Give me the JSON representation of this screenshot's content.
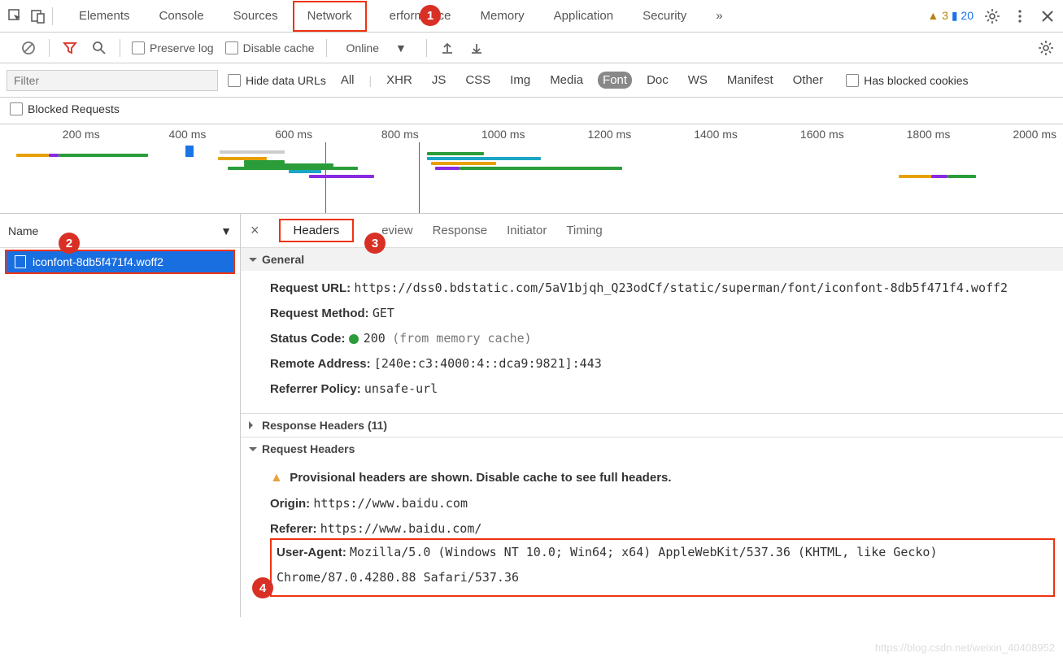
{
  "topTabs": [
    "Elements",
    "Console",
    "Sources",
    "Network",
    "Performance",
    "Memory",
    "Application",
    "Security"
  ],
  "topTabsVisible": {
    "perf": "erformance"
  },
  "warnings": {
    "warnCount": "3",
    "msgCount": "20"
  },
  "toolbar": {
    "preserveLog": "Preserve log",
    "disableCache": "Disable cache",
    "throttle": "Online"
  },
  "filterRow": {
    "placeholder": "Filter",
    "hideData": "Hide data URLs",
    "types": [
      "All",
      "XHR",
      "JS",
      "CSS",
      "Img",
      "Media",
      "Font",
      "Doc",
      "WS",
      "Manifest",
      "Other"
    ],
    "hasBlocked": "Has blocked cookies",
    "blockedReq": "Blocked Requests"
  },
  "timelineTicks": [
    "200 ms",
    "400 ms",
    "600 ms",
    "800 ms",
    "1000 ms",
    "1200 ms",
    "1400 ms",
    "1600 ms",
    "1800 ms",
    "2000 ms"
  ],
  "leftPane": {
    "nameHeader": "Name",
    "item": "iconfont-8db5f471f4.woff2"
  },
  "detailTabs": [
    "Headers",
    "Preview",
    "Response",
    "Initiator",
    "Timing"
  ],
  "detailTabsVisible": {
    "preview": "eview"
  },
  "general": {
    "title": "General",
    "url_lbl": "Request URL:",
    "url_val": "https://dss0.bdstatic.com/5aV1bjqh_Q23odCf/static/superman/font/iconfont-8db5f471f4.woff2",
    "method_lbl": "Request Method:",
    "method_val": "GET",
    "status_lbl": "Status Code:",
    "status_val": "200",
    "status_note": "(from memory cache)",
    "remote_lbl": "Remote Address:",
    "remote_val": "[240e:c3:4000:4::dca9:9821]:443",
    "refpol_lbl": "Referrer Policy:",
    "refpol_val": "unsafe-url"
  },
  "respHeaders": {
    "title": "Response Headers (11)"
  },
  "reqHeaders": {
    "title": "Request Headers",
    "provisional": "Provisional headers are shown. Disable cache to see full headers.",
    "origin_lbl": "Origin:",
    "origin_val": "https://www.baidu.com",
    "referer_lbl": "Referer:",
    "referer_val": "https://www.baidu.com/",
    "ua_lbl": "User-Agent:",
    "ua_val": "Mozilla/5.0 (Windows NT 10.0; Win64; x64) AppleWebKit/537.36 (KHTML, like Gecko) Chrome/87.0.4280.88 Safari/537.36"
  },
  "watermark": "https://blog.csdn.net/weixin_40408952",
  "badges": [
    "1",
    "2",
    "3",
    "4"
  ]
}
